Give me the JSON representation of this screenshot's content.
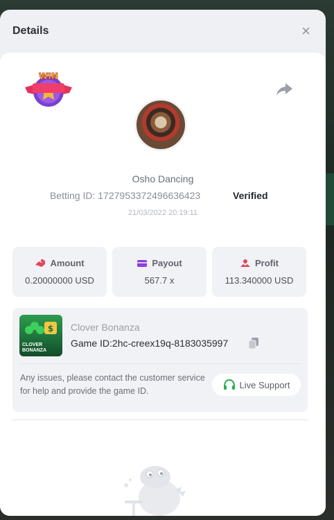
{
  "modal": {
    "title": "Details",
    "close_label": "×"
  },
  "bet": {
    "user_name": "Osho Dancing",
    "betting_id_label": "Betting ID:",
    "betting_id": "1727953372496636423",
    "status": "Verified",
    "timestamp": "21/03/2022 20:19:11",
    "badge_text": "WIN"
  },
  "stats": [
    {
      "label": "Amount",
      "value": "0.20000000 USD",
      "icon": "amount-icon",
      "color": "#e0475b"
    },
    {
      "label": "Payout",
      "value": "567.7 x",
      "icon": "payout-card-icon",
      "color": "#8b3fe0"
    },
    {
      "label": "Profit",
      "value": "113.340000 USD",
      "icon": "profit-icon",
      "color": "#e0475b"
    }
  ],
  "game": {
    "name": "Clover Bonanza",
    "id_label": "Game ID:",
    "id": "2hc-creex19q-8183035997",
    "thumb_text": "CLOVER BONANZA"
  },
  "support": {
    "help_text": "Any issues, please contact the customer service for help and provide the game ID.",
    "button_label": "Live Support",
    "accent": "#22b14c"
  }
}
